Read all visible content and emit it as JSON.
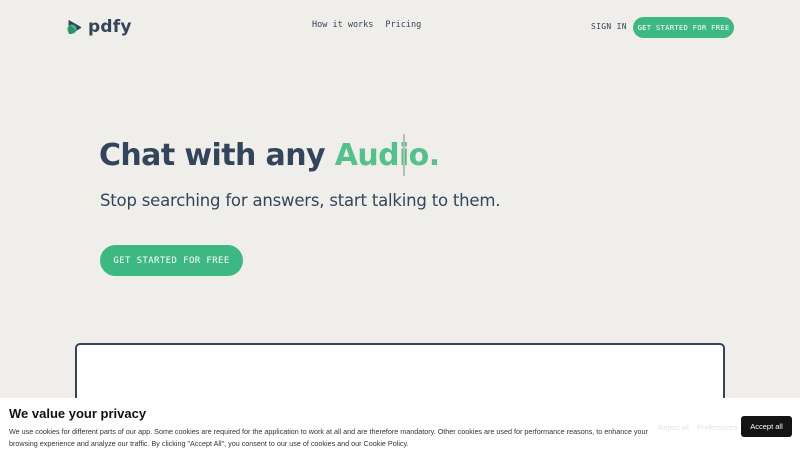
{
  "header": {
    "logo_text": "pdfy",
    "nav": [
      "How it works",
      "Pricing"
    ],
    "sign_in": "SIGN IN",
    "cta": "GET STARTED FOR FREE"
  },
  "hero": {
    "title_prefix": "Chat with any ",
    "title_accent": "Audio.",
    "subtitle": "Stop searching for answers, start talking to them.",
    "cta": "GET STARTED FOR FREE"
  },
  "cookie": {
    "title": "We value your privacy",
    "text": "We use cookies for different parts of our app. Some cookies are required for the application to work at all and are therefore mandatory. Other cookies are used for performance reasons, to enhance your browsing experience and analyze our traffic. By clicking \"Accept All\", you consent to our use of cookies and our Cookie Policy.",
    "reject_label": "Reject all",
    "preferences_label": "Preferences",
    "accept_label": "Accept all"
  },
  "colors": {
    "background": "#efeeea",
    "primary_text": "#34455b",
    "accent": "#55c08c",
    "button_green": "#3eb882",
    "accept_button": "#141414"
  }
}
